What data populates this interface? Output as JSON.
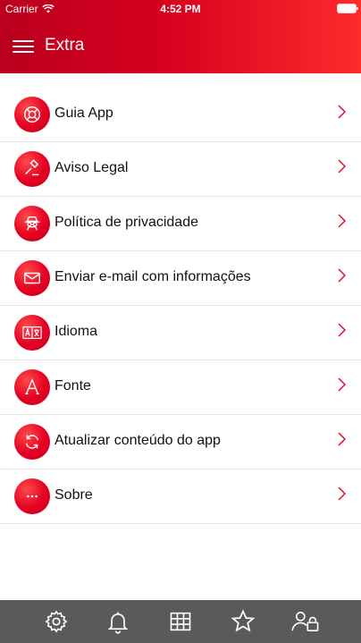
{
  "status_bar": {
    "carrier": "Carrier",
    "time": "4:52 PM"
  },
  "header": {
    "title": "Extra"
  },
  "menu": {
    "items": [
      {
        "label": "Guia App",
        "icon": "lifebuoy-icon"
      },
      {
        "label": "Aviso Legal",
        "icon": "gavel-icon"
      },
      {
        "label": "Política de privacidade",
        "icon": "incognito-spy-icon"
      },
      {
        "label": "Enviar e-mail com informações",
        "icon": "envelope-icon"
      },
      {
        "label": "Idioma",
        "icon": "translate-icon"
      },
      {
        "label": "Fonte",
        "icon": "font-a-icon"
      },
      {
        "label": "Atualizar conteúdo do app",
        "icon": "refresh-icon"
      },
      {
        "label": "Sobre",
        "icon": "more-dots-icon"
      }
    ]
  },
  "tabbar": {
    "tabs": [
      {
        "name": "settings",
        "icon": "gear-icon"
      },
      {
        "name": "notifications",
        "icon": "bell-icon"
      },
      {
        "name": "grid",
        "icon": "grid-icon"
      },
      {
        "name": "favorites",
        "icon": "star-icon"
      },
      {
        "name": "account",
        "icon": "user-lock-icon"
      }
    ]
  },
  "colors": {
    "accent": "#e40022",
    "header_dark": "#b9001d",
    "header_light": "#ff2a2a",
    "tabbar_bg": "#5a5a5a",
    "chevron": "#e40022"
  }
}
